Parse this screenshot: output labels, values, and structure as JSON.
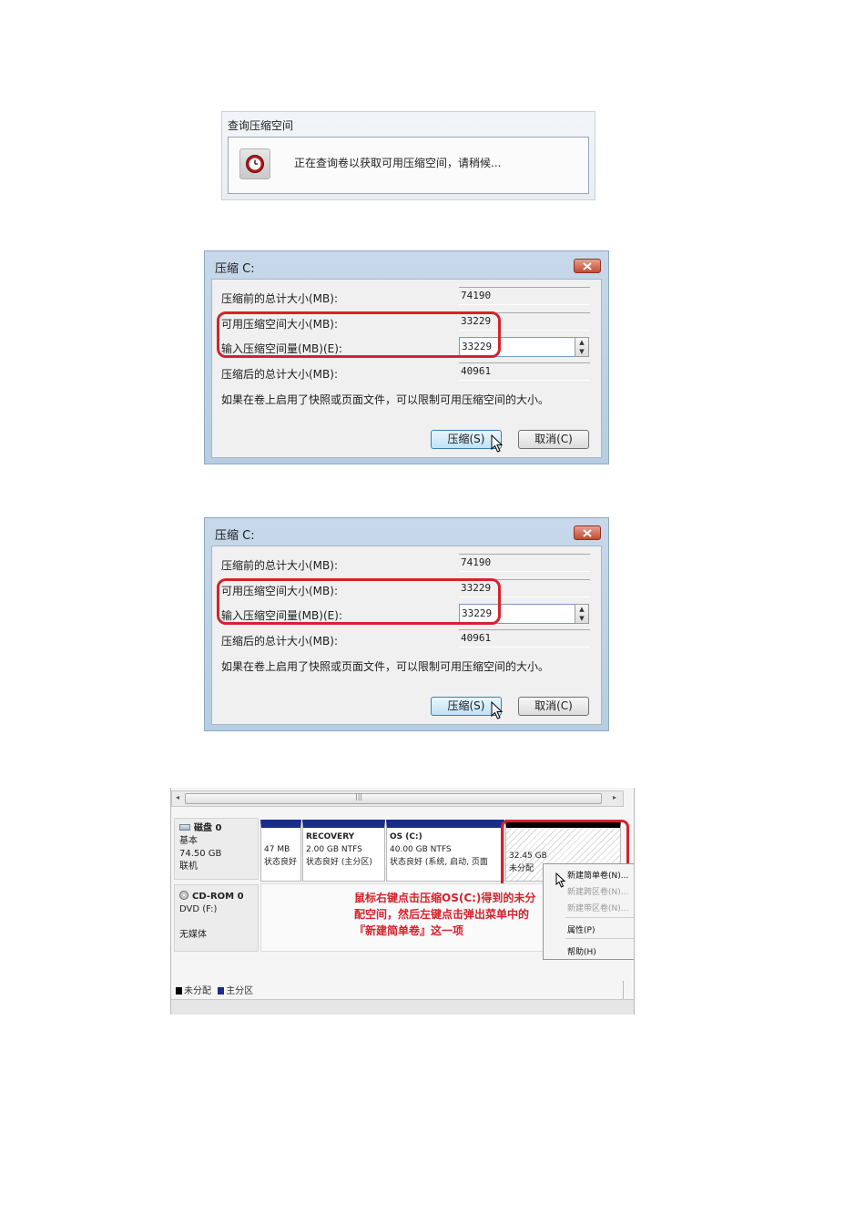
{
  "query_dialog": {
    "title": "查询压缩空间",
    "message": "正在查询卷以获取可用压缩空间，请稍候..."
  },
  "shrink_dialogs": [
    {
      "title": "压缩 C:",
      "fields": [
        {
          "label": "压缩前的总计大小(MB):",
          "value": "74190"
        },
        {
          "label": "可用压缩空间大小(MB):",
          "value": "33229"
        },
        {
          "label": "输入压缩空间量(MB)(E):",
          "value": "33229"
        },
        {
          "label": "压缩后的总计大小(MB):",
          "value": "40961"
        }
      ],
      "note": "如果在卷上启用了快照或页面文件，可以限制可用压缩空间的大小。",
      "ok_label": "压缩(S)",
      "cancel_label": "取消(C)"
    },
    {
      "title": "压缩 C:",
      "fields": [
        {
          "label": "压缩前的总计大小(MB):",
          "value": "74190"
        },
        {
          "label": "可用压缩空间大小(MB):",
          "value": "33229"
        },
        {
          "label": "输入压缩空间量(MB)(E):",
          "value": "33229"
        },
        {
          "label": "压缩后的总计大小(MB):",
          "value": "40961"
        }
      ],
      "note": "如果在卷上启用了快照或页面文件，可以限制可用压缩空间的大小。",
      "ok_label": "压缩(S)",
      "cancel_label": "取消(C)"
    }
  ],
  "disk_management": {
    "scroll_grip": "|||",
    "disk0": {
      "name": "磁盘 0",
      "type": "基本",
      "size": "74.50 GB",
      "status": "联机",
      "partitions": [
        {
          "name": "",
          "size": "47 MB",
          "status": "状态良好"
        },
        {
          "name": "RECOVERY",
          "size": "2.00 GB NTFS",
          "status": "状态良好 (主分区)"
        },
        {
          "name": "OS (C:)",
          "size": "40.00 GB NTFS",
          "status": "状态良好 (系统, 启动, 页面"
        }
      ],
      "unallocated": {
        "size": "32.45 GB",
        "status": "未分配"
      }
    },
    "cdrom": {
      "name": "CD-ROM 0",
      "drive": "DVD (F:)",
      "media": "无媒体"
    },
    "annotation": "鼠标右键点击压缩OS(C:)得到的未分配空间，然后左键点击弹出菜单中的『新建简单卷』这一项",
    "context_menu": [
      {
        "label": "新建简单卷(N)...",
        "enabled": true
      },
      {
        "label": "新建跨区卷(N)...",
        "enabled": false
      },
      {
        "label": "新建带区卷(N)...",
        "enabled": false
      },
      {
        "label": "属性(P)",
        "enabled": true
      },
      {
        "label": "帮助(H)",
        "enabled": true
      }
    ],
    "legend": [
      {
        "label": "未分配",
        "color": "#000000"
      },
      {
        "label": "主分区",
        "color": "#1a2d8a"
      }
    ]
  },
  "colors": {
    "highlight_red": "#d6222c",
    "primary_partition_blue": "#1a2d8a"
  }
}
